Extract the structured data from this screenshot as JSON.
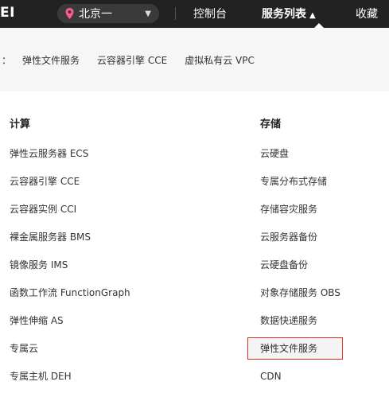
{
  "topbar": {
    "brand_fragment": "EI",
    "region": "北京一",
    "console": "控制台",
    "services": "服务列表",
    "services_caret": "▲",
    "favorites": "收藏"
  },
  "recent": {
    "colon": "：",
    "items": [
      "弹性文件服务",
      "云容器引擎 CCE",
      "虚拟私有云 VPC"
    ]
  },
  "columns": {
    "compute": {
      "title": "计算",
      "items": [
        "弹性云服务器 ECS",
        "云容器引擎 CCE",
        "云容器实例 CCI",
        "裸金属服务器 BMS",
        "镜像服务 IMS",
        "函数工作流 FunctionGraph",
        "弹性伸缩 AS",
        "专属云",
        "专属主机 DEH"
      ]
    },
    "storage": {
      "title": "存储",
      "items": [
        "云硬盘",
        "专属分布式存储",
        "存储容灾服务",
        "云服务器备份",
        "云硬盘备份",
        "对象存储服务 OBS",
        "数据快递服务",
        "弹性文件服务",
        "CDN"
      ]
    }
  },
  "colors": {
    "topbar_bg": "#222222",
    "region_pin": "#ff5b8c",
    "highlight_border": "#e0301e"
  }
}
